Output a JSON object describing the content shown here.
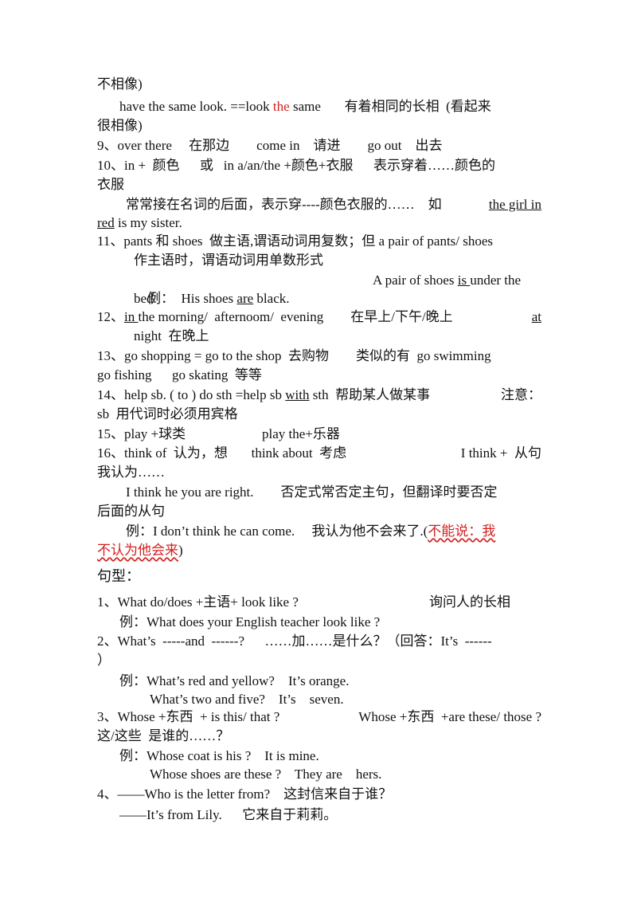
{
  "doc": {
    "l1": "不相像)",
    "l2a": "have the same look. ==look ",
    "l2b": "the",
    "l2c": " same       有着相同的长相  (看起来",
    "l3": "很相像)",
    "l4": "9、over there     在那边        come in    请进        go out    出去",
    "l5": "10、in +  颜色      或   in a/an/the +颜色+衣服      表示穿着……颜色的",
    "l6": "衣服",
    "l7a": "常常接在名词的后面，表示穿----颜色衣服的……    如 ",
    "l7b": "the girl in",
    "l8a": "red",
    "l8b": " is my sister.",
    "l9": "11、pants 和 shoes  做主语,谓语动词用复数；但 a pair of pants/ shoes",
    "l10": "作主语时，谓语动词用单数形式",
    "l11a": "例：  His shoes ",
    "l11b": "are",
    "l11c": " black.",
    "l11d": "A pair of shoes ",
    "l11e": "is ",
    "l11f": "under the",
    "l12": "bed.",
    "l13a": "12、",
    "l13b": "in ",
    "l13c": "the morning/  afternoom/  evening        在早上/下午/晚上",
    "l13d": "at",
    "l14": "night  在晚上",
    "l15": "13、go shopping = go to the shop  去购物        类似的有  go swimming",
    "l16": "go fishing      go skating  等等",
    "l17a": "14、help sb. ( to ) do sth =help sb ",
    "l17b": "with",
    "l17c": " sth  帮助某人做某事",
    "l17d": "注意：",
    "l18": "sb  用代词时必须用宾格",
    "l19a": "15、play +球类",
    "l19b": "play the+乐器",
    "l20a": "16、think of  认为，想       think about  考虑",
    "l20b": "I think +  从句",
    "l21": "我认为……",
    "l22": "I think he you are right.        否定式常否定主句，但翻译时要否定",
    "l23": "后面的从句",
    "l24a": "例：I don’t think he can come.     我认为他不会来了.(",
    "l24b": "不能说：我",
    "l25a": "不认为他会来",
    "l25b": ")",
    "h_sentence": "句型：",
    "s1a": "1、What do/does +主语+ look like ?",
    "s1b": "询问人的长相",
    "s1ex": "例：What does your English teacher look like ?",
    "s2": "2、What’s  -----and  ------?      ……加……是什么？（回答：It’s  ------",
    "s2b": "）",
    "s2ex1": "例：What’s red and yellow?    It’s orange.",
    "s2ex2": "What’s two and five?    It’s    seven.",
    "s3a": "3、Whose +东西  + is this/ that ?",
    "s3b": "Whose +东西  +are these/ those ?",
    "s3c": "这/这些  是谁的……？",
    "s3ex1": "例：Whose coat is his ?    It is mine.",
    "s3ex2": "Whose shoes are these ?    They are    hers.",
    "s4a": "4、——Who is the letter from?    这封信来自于谁？",
    "s4b": "——It’s from Lily.      它来自于莉莉。"
  },
  "colors": {
    "accent_red": "#d42020",
    "text": "#111111"
  }
}
